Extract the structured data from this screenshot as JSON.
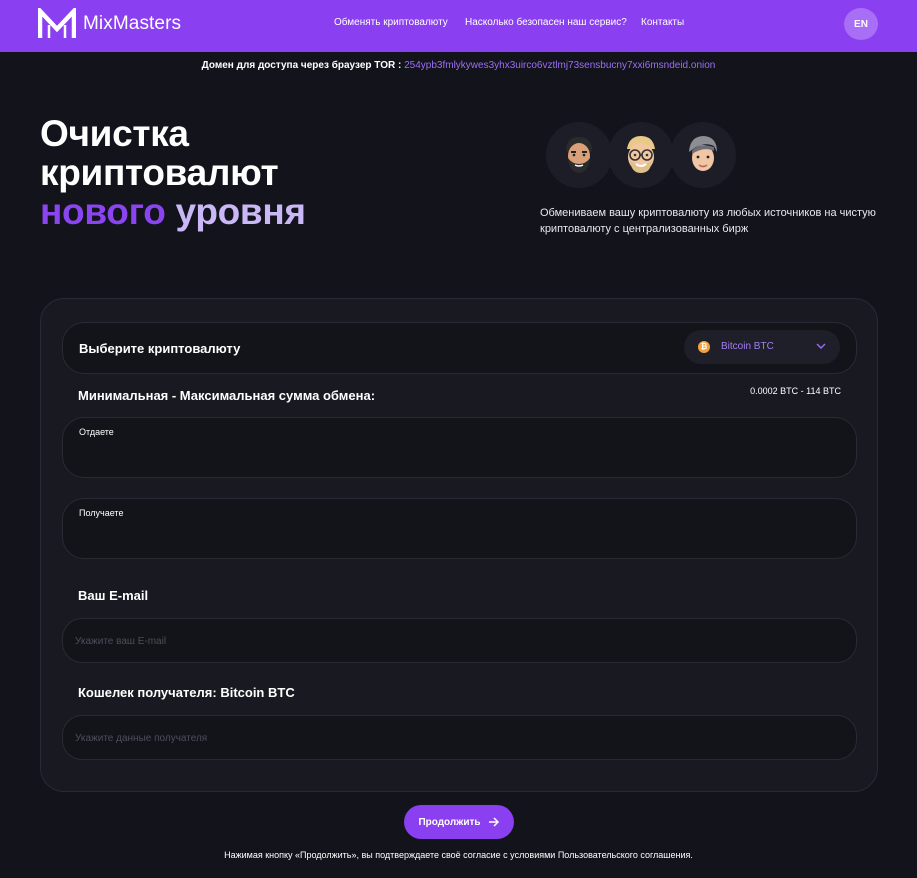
{
  "header": {
    "brand": "MixMasters",
    "nav": [
      {
        "label": "Обменять криптовалюту"
      },
      {
        "label": "Насколько безопасен наш сервис?"
      },
      {
        "label": "Контакты"
      }
    ],
    "lang": "EN",
    "colors": {
      "navbar": "#8a3ff0",
      "accent": "#9b6ef5"
    }
  },
  "tor": {
    "label": "Домен для доступа через браузер TOR :",
    "domain": "254ypb3fmlykywes3yhx3uirco6vztlmj73sensbucny7xxi6msndeid.onion"
  },
  "hero": {
    "title_line1": "Очистка",
    "title_line2": "криптовалют",
    "title_accent1": "нового",
    "title_accent2": "уровня",
    "description": "Обмениваем вашу криптовалюту из любых источников на чистую криптовалюту с централизованных бирж",
    "avatars": [
      "bearded-man-avatar-icon",
      "blonde-glasses-avatar-icon",
      "gray-hair-avatar-icon"
    ]
  },
  "form": {
    "select_label": "Выберите криптовалюту",
    "selected_coin": "Bitcoin BTC",
    "coin_icon": "bitcoin-icon",
    "range_label": "Минимальная - Максимальная сумма обмена:",
    "range_value": "0.0002 BTC - 114 BTC",
    "give_caption": "Отдаете",
    "receive_caption": "Получаете",
    "email_label": "Ваш E-mail",
    "email_placeholder": "Укажите ваш E-mail",
    "wallet_label": "Кошелек получателя: Bitcoin BTC",
    "wallet_placeholder": "Укажите данные получателя"
  },
  "footer": {
    "continue_label": "Продолжить",
    "agreement": "Нажимая кнопку «Продолжить», вы подтверждаете своё согласие с условиями Пользовательского соглашения."
  }
}
